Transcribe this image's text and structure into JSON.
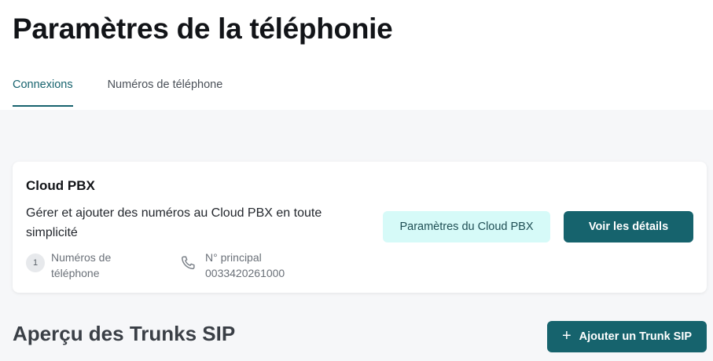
{
  "page": {
    "title": "Paramètres de la téléphonie"
  },
  "tabs": [
    {
      "label": "Connexions",
      "active": true
    },
    {
      "label": "Numéros de téléphone",
      "active": false
    }
  ],
  "cloud_pbx_card": {
    "title": "Cloud PBX",
    "description": "Gérer et ajouter des numéros au Cloud PBX en toute simplicité",
    "phone_count": {
      "value": "1",
      "label": "Numéros de téléphone"
    },
    "main_number": {
      "label": "N° principal",
      "value": "0033420261000",
      "icon": "phone-icon"
    },
    "settings_button": "Paramètres du Cloud PBX",
    "details_button": "Voir les détails"
  },
  "sip_trunks": {
    "title": "Aperçu des Trunks SIP",
    "add_button": "Ajouter un Trunk SIP",
    "add_icon": "plus-icon"
  },
  "colors": {
    "accent": "#16636d",
    "secondary_button_bg": "#d6faf8",
    "content_bg": "#f6f7f9"
  }
}
